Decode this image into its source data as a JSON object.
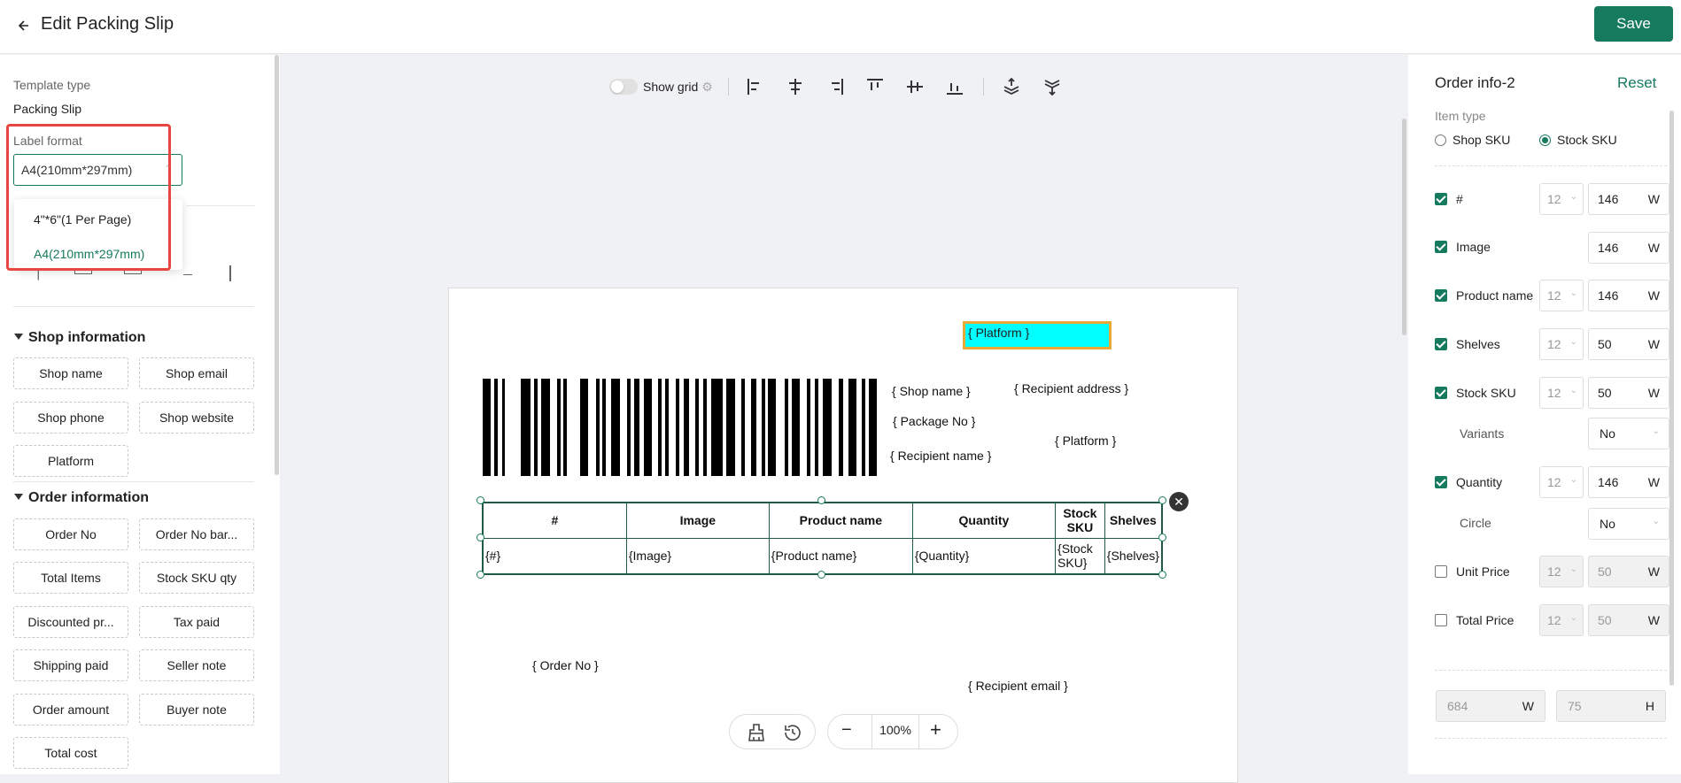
{
  "header": {
    "title": "Edit Packing Slip",
    "save_label": "Save"
  },
  "left": {
    "template_type_label": "Template type",
    "template_type_value": "Packing Slip",
    "label_format_label": "Label format",
    "label_format_value": "A4(210mm*297mm)",
    "dropdown_options": [
      "4\"*6\"(1 Per Page)",
      "A4(210mm*297mm)"
    ],
    "shop_section": "Shop information",
    "shop_fields": [
      "Shop name",
      "Shop email",
      "Shop phone",
      "Shop website",
      "Platform"
    ],
    "order_section": "Order information",
    "order_fields": [
      "Order No",
      "Order No bar...",
      "Total Items",
      "Stock SKU qty",
      "Discounted pr...",
      "Tax paid",
      "Shipping paid",
      "Seller note",
      "Order amount",
      "Buyer note",
      "Total cost"
    ]
  },
  "toolbar": {
    "show_grid_label": "Show grid"
  },
  "canvas": {
    "platform_highlight": "{ Platform }",
    "shop_name": "{ Shop name }",
    "recipient_address": "{ Recipient address }",
    "package_no": "{ Package No }",
    "platform": "{ Platform }",
    "recipient_name": "{ Recipient name }",
    "order_no": "{ Order No }",
    "recipient_email": "{ Recipient email }",
    "table_headers": [
      "#",
      "Image",
      "Product name",
      "Quantity",
      "Stock SKU",
      "Shelves"
    ],
    "table_row": [
      "{#}",
      "{Image}",
      "{Product name}",
      "{Quantity}",
      "{Stock SKU}",
      "{Shelves}"
    ]
  },
  "zoom": {
    "value": "100%"
  },
  "right": {
    "title": "Order info-2",
    "reset_label": "Reset",
    "item_type_label": "Item type",
    "item_type_options": [
      "Shop SKU",
      "Stock SKU"
    ],
    "rows": [
      {
        "label": "#",
        "checked": true,
        "size": "12",
        "width": "146",
        "unit": "W"
      },
      {
        "label": "Image",
        "checked": true,
        "size": "",
        "width": "146",
        "unit": "W"
      },
      {
        "label": "Product name",
        "checked": true,
        "size": "12",
        "width": "146",
        "unit": "W"
      },
      {
        "label": "Shelves",
        "checked": true,
        "size": "12",
        "width": "50",
        "unit": "W"
      },
      {
        "label": "Stock SKU",
        "checked": true,
        "size": "12",
        "width": "50",
        "unit": "W"
      },
      {
        "label": "Quantity",
        "checked": true,
        "size": "12",
        "width": "146",
        "unit": "W"
      },
      {
        "label": "Unit Price",
        "checked": false,
        "size": "12",
        "width": "50",
        "unit": "W"
      },
      {
        "label": "Total Price",
        "checked": false,
        "size": "12",
        "width": "50",
        "unit": "W"
      }
    ],
    "variants_label": "Variants",
    "variants_value": "No",
    "circle_label": "Circle",
    "circle_value": "No",
    "dim_w": "684",
    "dim_w_unit": "W",
    "dim_h": "75",
    "dim_h_unit": "H"
  }
}
